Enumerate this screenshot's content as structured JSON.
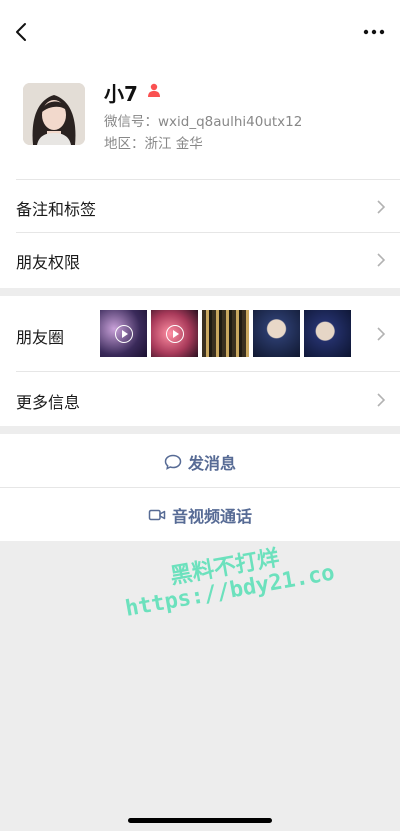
{
  "profile": {
    "name": "小7",
    "wechat_id_line": "微信号：wxid_q8aulhi40utx12",
    "region_line": "地区：浙江 金华"
  },
  "rows": {
    "remark_label": "备注和标签",
    "friend_permission_label": "朋友权限",
    "moments_label": "朋友圈",
    "more_info_label": "更多信息"
  },
  "actions": {
    "send_message_label": "发消息",
    "video_call_label": "音视频通话"
  },
  "watermark": {
    "line1": "黑料不打烊",
    "line2": "https://bdy21.co"
  },
  "colors": {
    "link": "#576b95",
    "gender_female": "#fa5151",
    "watermark": "#5fe0b8"
  },
  "icons": {
    "back": "chevron-left-icon",
    "more": "more-dots-icon",
    "gender": "female-icon",
    "chat": "chat-bubble-icon",
    "video": "video-camera-icon"
  }
}
